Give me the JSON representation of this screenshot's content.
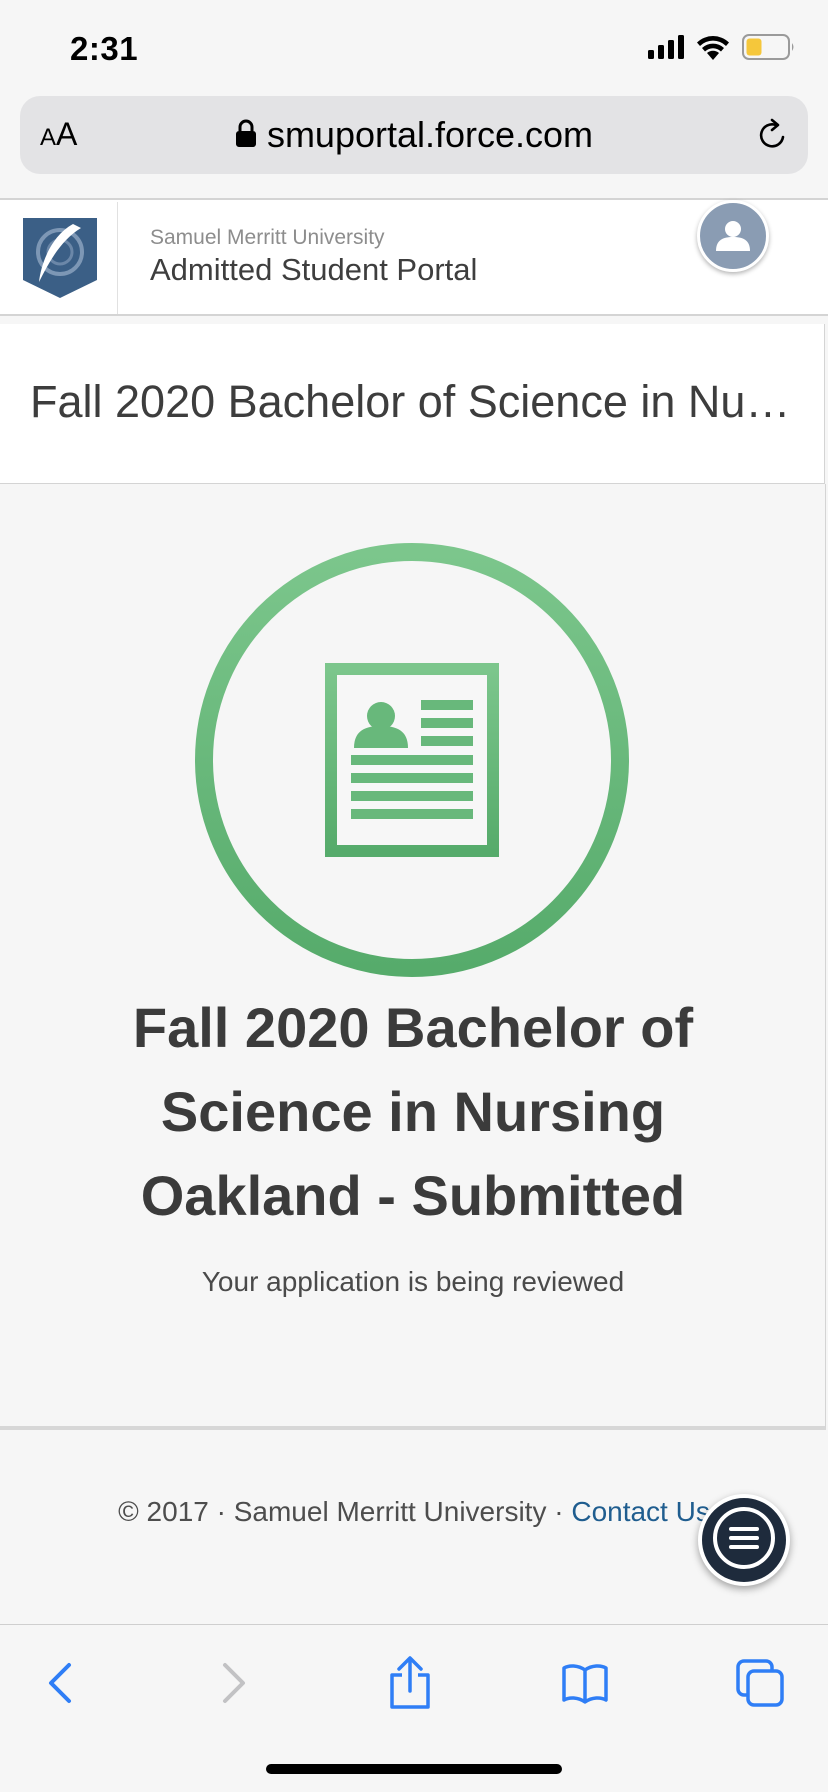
{
  "status_bar": {
    "time": "2:31",
    "icons": [
      "cellular-signal-icon",
      "wifi-icon",
      "battery-icon"
    ],
    "battery_color": "#f5c73b"
  },
  "browser": {
    "text_size_button": {
      "small": "A",
      "large": "A"
    },
    "url": "smuportal.force.com",
    "icons": [
      "lock-icon",
      "reload-icon"
    ]
  },
  "header": {
    "university": "Samuel Merritt University",
    "portal_name": "Admitted Student Portal",
    "icons": [
      "university-logo",
      "user-avatar-icon"
    ]
  },
  "program": {
    "title": "Fall 2020 Bachelor of Science in Nursing Oakland"
  },
  "application_status": {
    "heading": "Fall 2020 Bachelor of Science in Nursing Oakland - Submitted",
    "message": "Your application is being reviewed",
    "icon": "application-document-icon",
    "accent_color": "#5fb374"
  },
  "footer": {
    "copyright": "© 2017 · Samuel Merritt University · ",
    "contact_link": "Contact Us",
    "chat_icon": "chat-menu-icon"
  },
  "toolbar": {
    "icons": [
      "back-icon",
      "forward-icon",
      "share-icon",
      "bookmarks-icon",
      "tabs-icon"
    ],
    "accent_color": "#2f7ef6"
  }
}
